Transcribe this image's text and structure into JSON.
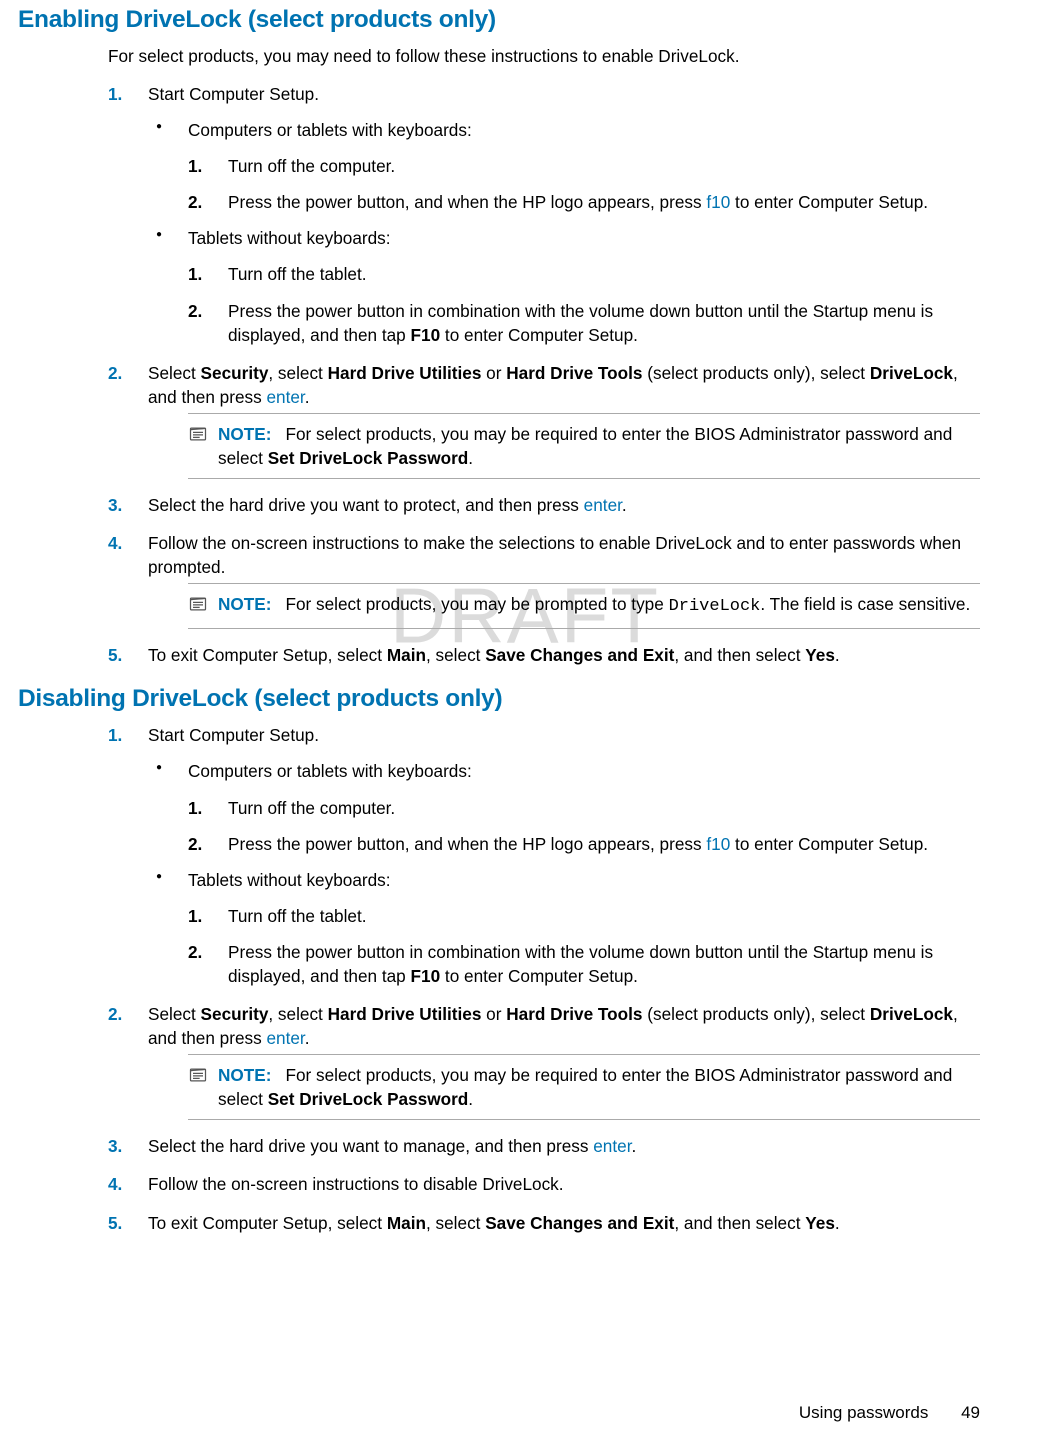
{
  "watermark": "DRAFT",
  "footer": {
    "section": "Using passwords",
    "page": "49"
  },
  "enabling": {
    "heading": "Enabling DriveLock (select products only)",
    "intro": "For select products, you may need to follow these instructions to enable DriveLock.",
    "steps": {
      "s1": {
        "num": "1.",
        "text": "Start Computer Setup."
      },
      "s1_b1_label": "Computers or tablets with keyboards:",
      "s1_b1_sub1": {
        "num": "1.",
        "text": "Turn off the computer."
      },
      "s1_b1_sub2": {
        "num": "2.",
        "pre": "Press the power button, and when the HP logo appears, press ",
        "key": "f10",
        "post": " to enter Computer Setup."
      },
      "s1_b2_label": "Tablets without keyboards:",
      "s1_b2_sub1": {
        "num": "1.",
        "text": "Turn off the tablet."
      },
      "s1_b2_sub2": {
        "num": "2.",
        "pre": "Press the power button in combination with the volume down button until the Startup menu is displayed, and then tap ",
        "key_bold": "F10",
        "post": " to enter Computer Setup."
      },
      "s2": {
        "num": "2.",
        "t1": "Select ",
        "b1": "Security",
        "t2": ", select ",
        "b2": "Hard Drive Utilities",
        "t3": " or ",
        "b3": "Hard Drive Tools",
        "t4": " (select products only), select ",
        "b4": "DriveLock",
        "t5": ", and then press ",
        "key": "enter",
        "t6": "."
      },
      "note1": {
        "label": "NOTE:",
        "t1": "For select products, you may be required to enter the BIOS Administrator password and select ",
        "b1": "Set DriveLock Password",
        "t2": "."
      },
      "s3": {
        "num": "3.",
        "t1": "Select the hard drive you want to protect, and then press ",
        "key": "enter",
        "t2": "."
      },
      "s4": {
        "num": "4.",
        "text": "Follow the on-screen instructions to make the selections to enable DriveLock and to enter passwords when prompted."
      },
      "note2": {
        "label": "NOTE:",
        "t1": "For select products, you may be prompted to type ",
        "mono": "DriveLock",
        "t2": ". The field is case sensitive."
      },
      "s5": {
        "num": "5.",
        "t1": "To exit Computer Setup, select ",
        "b1": "Main",
        "t2": ", select ",
        "b2": "Save Changes and Exit",
        "t3": ", and then select ",
        "b3": "Yes",
        "t4": "."
      }
    }
  },
  "disabling": {
    "heading": "Disabling DriveLock (select products only)",
    "steps": {
      "s1": {
        "num": "1.",
        "text": "Start Computer Setup."
      },
      "s1_b1_label": "Computers or tablets with keyboards:",
      "s1_b1_sub1": {
        "num": "1.",
        "text": "Turn off the computer."
      },
      "s1_b1_sub2": {
        "num": "2.",
        "pre": "Press the power button, and when the HP logo appears, press ",
        "key": "f10",
        "post": " to enter Computer Setup."
      },
      "s1_b2_label": "Tablets without keyboards:",
      "s1_b2_sub1": {
        "num": "1.",
        "text": "Turn off the tablet."
      },
      "s1_b2_sub2": {
        "num": "2.",
        "pre": "Press the power button in combination with the volume down button until the Startup menu is displayed, and then tap ",
        "key_bold": "F10",
        "post": " to enter Computer Setup."
      },
      "s2": {
        "num": "2.",
        "t1": "Select ",
        "b1": "Security",
        "t2": ", select ",
        "b2": "Hard Drive Utilities",
        "t3": " or ",
        "b3": "Hard Drive Tools",
        "t4": " (select products only), select ",
        "b4": "DriveLock",
        "t5": ", and then press ",
        "key": "enter",
        "t6": "."
      },
      "note1": {
        "label": "NOTE:",
        "t1": "For select products, you may be required to enter the BIOS Administrator password and select ",
        "b1": "Set DriveLock Password",
        "t2": "."
      },
      "s3": {
        "num": "3.",
        "t1": "Select the hard drive you want to manage, and then press ",
        "key": "enter",
        "t2": "."
      },
      "s4": {
        "num": "4.",
        "text": "Follow the on-screen instructions to disable DriveLock."
      },
      "s5": {
        "num": "5.",
        "t1": "To exit Computer Setup, select ",
        "b1": "Main",
        "t2": ", select ",
        "b2": "Save Changes and Exit",
        "t3": ", and then select ",
        "b3": "Yes",
        "t4": "."
      }
    }
  }
}
